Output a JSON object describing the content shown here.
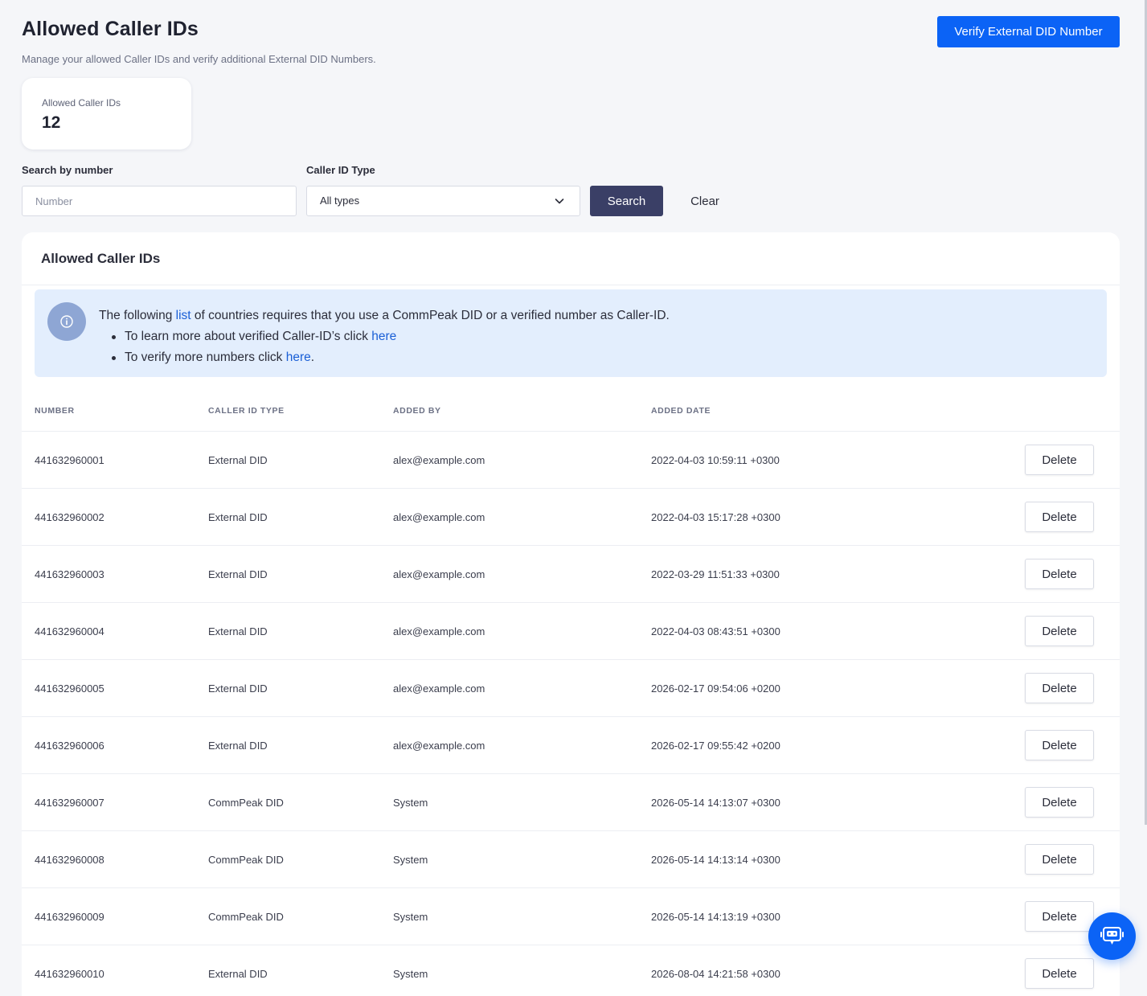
{
  "header": {
    "title": "Allowed Caller IDs",
    "subtitle": "Manage your allowed Caller IDs and verify additional External DID Numbers.",
    "verify_button": "Verify External DID Number"
  },
  "stat": {
    "label": "Allowed Caller IDs",
    "value": "12"
  },
  "filters": {
    "number_label": "Search by number",
    "number_placeholder": "Number",
    "number_value": "",
    "type_label": "Caller ID Type",
    "type_selected": "All types",
    "search_button": "Search",
    "clear_button": "Clear"
  },
  "panel": {
    "title": "Allowed Caller IDs",
    "info": {
      "line_prefix": "The following ",
      "line_link": "list",
      "line_suffix": " of countries requires that you use a CommPeak DID or a verified number as Caller-ID.",
      "bullet1_text": "To learn more about verified Caller-ID’s click ",
      "bullet1_link": "here",
      "bullet2_text": "To verify more numbers click ",
      "bullet2_link": "here",
      "bullet2_end": "."
    }
  },
  "table": {
    "headers": [
      "NUMBER",
      "CALLER ID TYPE",
      "ADDED BY",
      "ADDED DATE"
    ],
    "delete_label": "Delete",
    "rows": [
      {
        "number": "441632960001",
        "type": "External DID",
        "added_by": "alex@example.com",
        "date": "2022-04-03 10:59:11 +0300"
      },
      {
        "number": "441632960002",
        "type": "External DID",
        "added_by": "alex@example.com",
        "date": "2022-04-03 15:17:28 +0300"
      },
      {
        "number": "441632960003",
        "type": "External DID",
        "added_by": "alex@example.com",
        "date": "2022-03-29 11:51:33 +0300"
      },
      {
        "number": "441632960004",
        "type": "External DID",
        "added_by": "alex@example.com",
        "date": "2022-04-03 08:43:51 +0300"
      },
      {
        "number": "441632960005",
        "type": "External DID",
        "added_by": "alex@example.com",
        "date": "2026-02-17 09:54:06 +0200"
      },
      {
        "number": "441632960006",
        "type": "External DID",
        "added_by": "alex@example.com",
        "date": "2026-02-17 09:55:42 +0200"
      },
      {
        "number": "441632960007",
        "type": "CommPeak DID",
        "added_by": "System",
        "date": "2026-05-14 14:13:07 +0300"
      },
      {
        "number": "441632960008",
        "type": "CommPeak DID",
        "added_by": "System",
        "date": "2026-05-14 14:13:14 +0300"
      },
      {
        "number": "441632960009",
        "type": "CommPeak DID",
        "added_by": "System",
        "date": "2026-05-14 14:13:19 +0300"
      },
      {
        "number": "441632960010",
        "type": "External DID",
        "added_by": "System",
        "date": "2026-08-04 14:21:58 +0300"
      }
    ]
  },
  "icons": {
    "info": "info-icon",
    "chevron": "chevron-down-icon",
    "chat": "chat-bot-icon"
  },
  "colors": {
    "primary": "#0b63f6",
    "search_button": "#3a3f66",
    "info_bg": "#e3eefd",
    "link": "#1a5fd6"
  }
}
